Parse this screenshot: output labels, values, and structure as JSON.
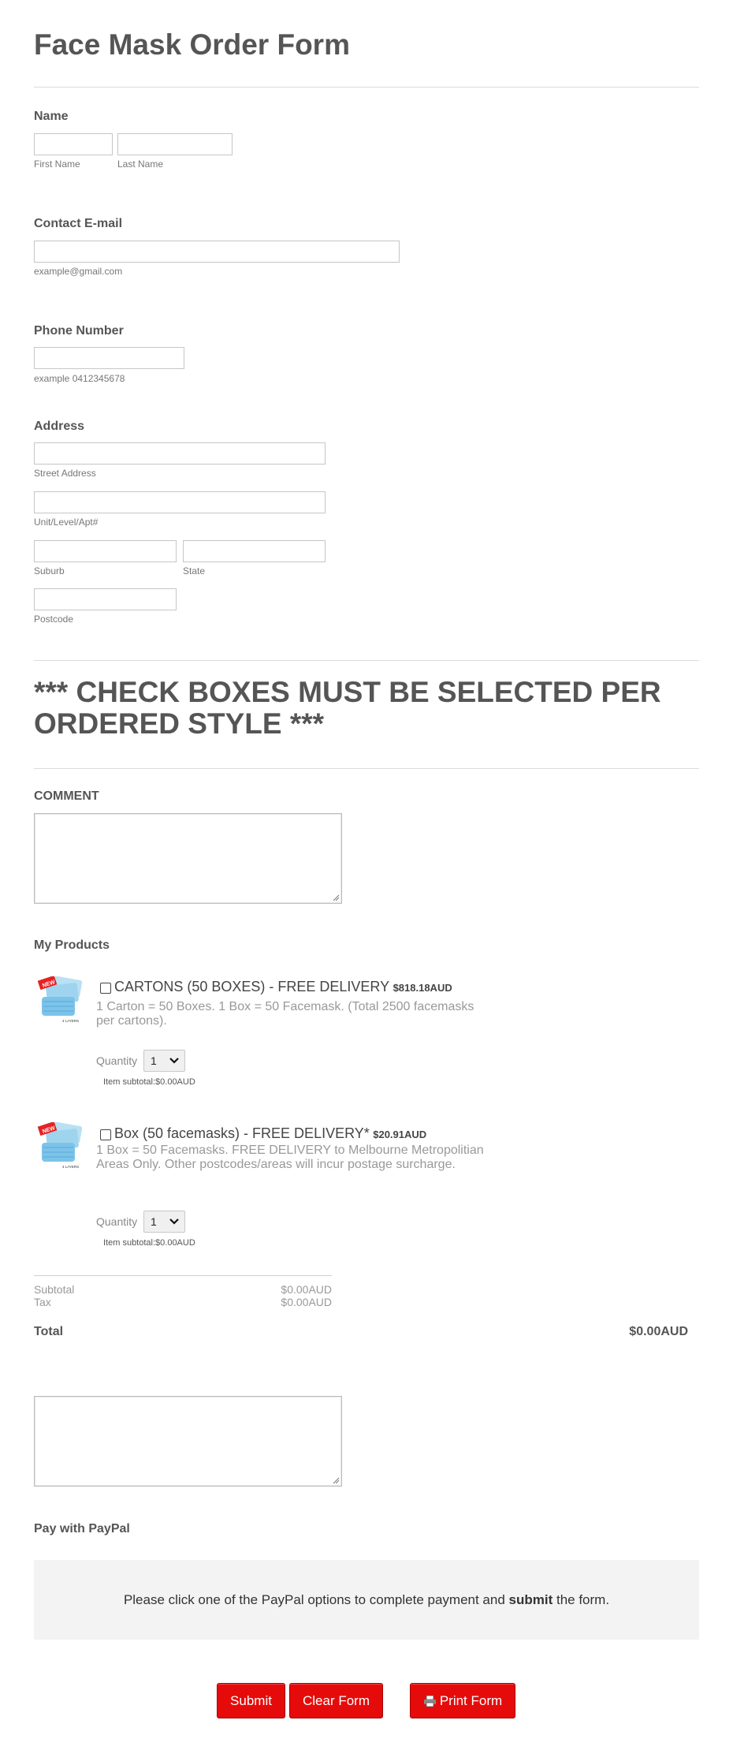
{
  "form": {
    "title": "Face Mask Order Form"
  },
  "name": {
    "label": "Name",
    "first_sub": "First Name",
    "last_sub": "Last Name",
    "first_value": "",
    "last_value": ""
  },
  "email": {
    "label": "Contact E-mail",
    "sub": "example@gmail.com",
    "value": ""
  },
  "phone": {
    "label": "Phone Number",
    "sub": "example 0412345678",
    "value": ""
  },
  "address": {
    "label": "Address",
    "street_sub": "Street Address",
    "unit_sub": "Unit/Level/Apt#",
    "suburb_sub": "Suburb",
    "state_sub": "State",
    "postcode_sub": "Postcode"
  },
  "notice": {
    "text": "*** CHECK BOXES MUST BE SELECTED PER ORDERED STYLE ***"
  },
  "comment": {
    "label": "COMMENT",
    "value": ""
  },
  "products": {
    "label": "My Products",
    "items": [
      {
        "title": "CARTONS (50 BOXES) - FREE DELIVERY",
        "price": "$818.18AUD",
        "description": "1 Carton = 50 Boxes. 1 Box = 50 Facemask. (Total 2500 facemasks per cartons).",
        "quantity_label": "Quantity",
        "quantity": "1",
        "subtotal": "Item subtotal:$0.00AUD",
        "checked": false,
        "image_badge": "NEW",
        "image_caption": "4 LAYERS"
      },
      {
        "title": "Box (50 facemasks) - FREE DELIVERY*",
        "price": "$20.91AUD",
        "description": "1 Box = 50 Facemasks. FREE DELIVERY to Melbourne Metropolitian Areas Only. Other postcodes/areas will incur postage surcharge.",
        "quantity_label": "Quantity",
        "quantity": "1",
        "subtotal": "Item subtotal:$0.00AUD",
        "checked": false,
        "image_badge": "NEW",
        "image_caption": "4 LAYERS"
      }
    ]
  },
  "summary": {
    "subtotal_label": "Subtotal",
    "subtotal_value": "$0.00AUD",
    "tax_label": "Tax",
    "tax_value": "$0.00AUD",
    "total_label": "Total",
    "total_value": "$0.00AUD"
  },
  "paypal": {
    "label": "Pay with PayPal",
    "message_before": "Please click one of the PayPal options to complete payment and ",
    "message_bold": "submit",
    "message_after": " the form."
  },
  "buttons": {
    "submit": "Submit",
    "clear": "Clear Form",
    "print": "Print Form"
  },
  "colors": {
    "button_red": "#e60b0b",
    "text_dark": "#555555",
    "text_muted": "#999999",
    "paypal_bg": "#f3f3f3"
  },
  "icons": {
    "print": "printer-icon",
    "select": "chevron-down-icon"
  }
}
